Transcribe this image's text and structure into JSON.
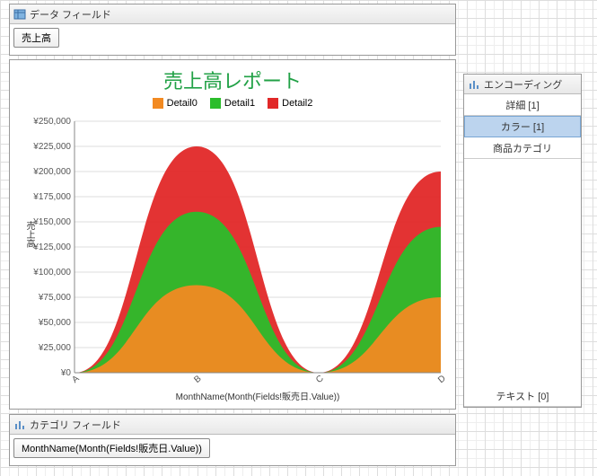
{
  "dataFields": {
    "title": "データ フィールド",
    "field": "売上高"
  },
  "categoryFields": {
    "title": "カテゴリ フィールド",
    "field": "MonthName(Month(Fields!販売日.Value))"
  },
  "encoding": {
    "title": "エンコーディング",
    "items": [
      "詳細 [1]",
      "カラー [1]",
      "商品カテゴリ"
    ],
    "selectedIndex": 1,
    "textItem": "テキスト [0]"
  },
  "chart_data": {
    "type": "area",
    "title": "売上高レポート",
    "xlabel": "MonthName(Month(Fields!販売日.Value))",
    "ylabel": "売上高",
    "categories": [
      "A",
      "B",
      "C",
      "D"
    ],
    "ylim": [
      0,
      250000
    ],
    "yticks": [
      0,
      25000,
      50000,
      75000,
      100000,
      125000,
      150000,
      175000,
      200000,
      225000,
      250000
    ],
    "ytickLabels": [
      "¥0",
      "¥25,000",
      "¥50,000",
      "¥75,000",
      "¥100,000",
      "¥125,000",
      "¥150,000",
      "¥175,000",
      "¥200,000",
      "¥225,000",
      "¥250,000"
    ],
    "series": [
      {
        "name": "Detail0",
        "color": "#f28a22",
        "values": [
          0,
          87000,
          0,
          75000
        ]
      },
      {
        "name": "Detail1",
        "color": "#2bbd2b",
        "values": [
          0,
          160000,
          0,
          145000
        ]
      },
      {
        "name": "Detail2",
        "color": "#e12828",
        "values": [
          0,
          225000,
          0,
          200000
        ]
      }
    ]
  }
}
